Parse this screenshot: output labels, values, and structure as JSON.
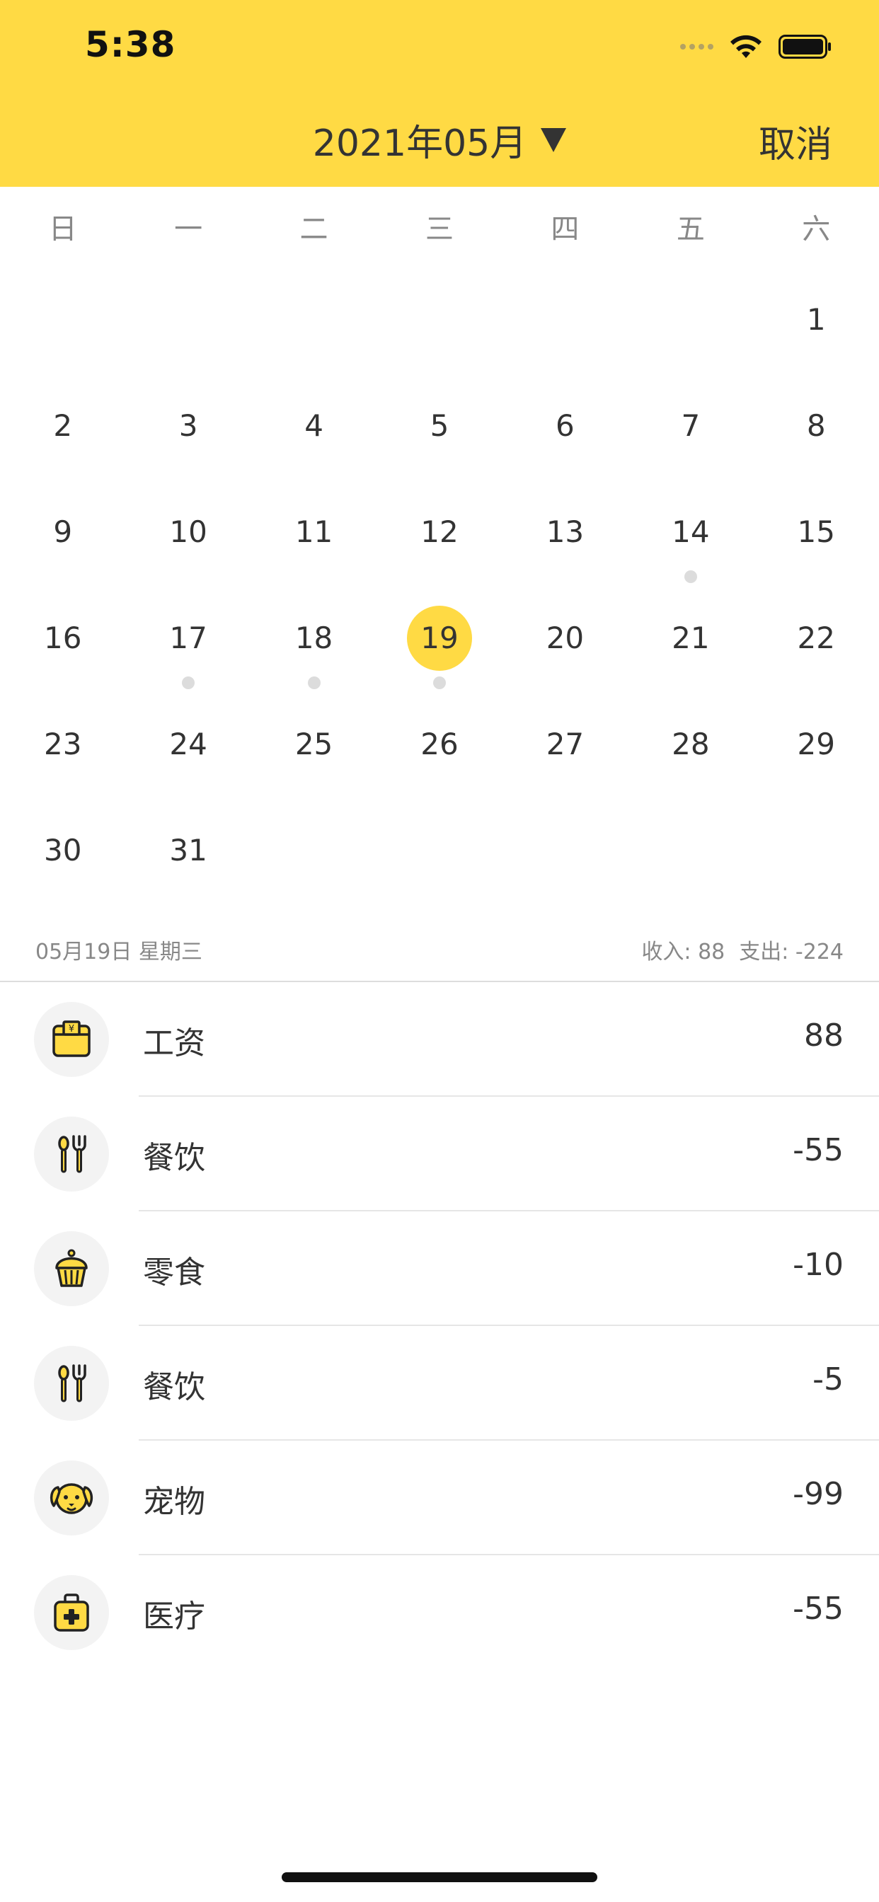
{
  "status_bar": {
    "time": "5:38"
  },
  "header": {
    "month_title": "2021年05月",
    "cancel_label": "取消",
    "accent_color": "#FFDA44"
  },
  "weekdays": [
    "日",
    "一",
    "二",
    "三",
    "四",
    "五",
    "六"
  ],
  "calendar": {
    "leading_blank_days": 6,
    "selected_day": 19,
    "days": [
      {
        "d": "1",
        "dot": false
      },
      {
        "d": "2",
        "dot": false
      },
      {
        "d": "3",
        "dot": false
      },
      {
        "d": "4",
        "dot": false
      },
      {
        "d": "5",
        "dot": false
      },
      {
        "d": "6",
        "dot": false
      },
      {
        "d": "7",
        "dot": false
      },
      {
        "d": "8",
        "dot": false
      },
      {
        "d": "9",
        "dot": false
      },
      {
        "d": "10",
        "dot": false
      },
      {
        "d": "11",
        "dot": false
      },
      {
        "d": "12",
        "dot": false
      },
      {
        "d": "13",
        "dot": false
      },
      {
        "d": "14",
        "dot": true
      },
      {
        "d": "15",
        "dot": false
      },
      {
        "d": "16",
        "dot": false
      },
      {
        "d": "17",
        "dot": true
      },
      {
        "d": "18",
        "dot": true
      },
      {
        "d": "19",
        "dot": true
      },
      {
        "d": "20",
        "dot": false
      },
      {
        "d": "21",
        "dot": false
      },
      {
        "d": "22",
        "dot": false
      },
      {
        "d": "23",
        "dot": false
      },
      {
        "d": "24",
        "dot": false
      },
      {
        "d": "25",
        "dot": false
      },
      {
        "d": "26",
        "dot": false
      },
      {
        "d": "27",
        "dot": false
      },
      {
        "d": "28",
        "dot": false
      },
      {
        "d": "29",
        "dot": false
      },
      {
        "d": "30",
        "dot": false
      },
      {
        "d": "31",
        "dot": false
      }
    ]
  },
  "summary": {
    "date_label": "05月19日 星期三",
    "income": "收入: 88",
    "expense": "支出: -224"
  },
  "records": [
    {
      "category": "工资",
      "amount": "88",
      "icon": "wallet-icon"
    },
    {
      "category": "餐饮",
      "amount": "-55",
      "icon": "fork-spoon-icon"
    },
    {
      "category": "零食",
      "amount": "-10",
      "icon": "muffin-icon"
    },
    {
      "category": "餐饮",
      "amount": "-5",
      "icon": "fork-spoon-icon"
    },
    {
      "category": "宠物",
      "amount": "-99",
      "icon": "dog-icon"
    },
    {
      "category": "医疗",
      "amount": "-55",
      "icon": "medical-kit-icon"
    }
  ]
}
